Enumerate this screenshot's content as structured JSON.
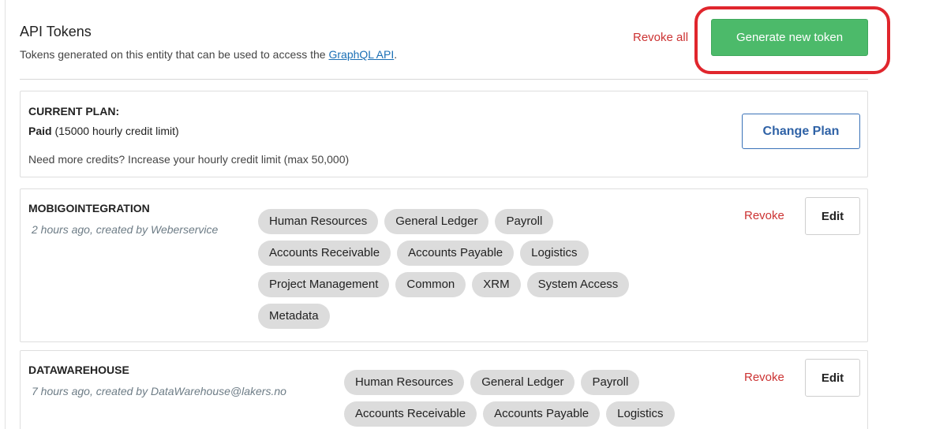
{
  "header": {
    "title": "API Tokens",
    "description_prefix": "Tokens generated on this entity that can be used to access the ",
    "description_link": "GraphQL API",
    "description_suffix": ".",
    "revoke_all_label": "Revoke all",
    "generate_label": "Generate new token"
  },
  "plan": {
    "label": "CURRENT PLAN:",
    "tier": "Paid",
    "limit": "(15000 hourly credit limit)",
    "upsell": "Need more credits? Increase your hourly credit limit (max 50,000)",
    "change_label": "Change Plan"
  },
  "tokens": [
    {
      "name": "MOBIGOINTEGRATION",
      "meta": "2 hours ago, created by Weberservice",
      "scopes": [
        "Human Resources",
        "General Ledger",
        "Payroll",
        "Accounts Receivable",
        "Accounts Payable",
        "Logistics",
        "Project Management",
        "Common",
        "XRM",
        "System Access",
        "Metadata"
      ],
      "revoke_label": "Revoke",
      "edit_label": "Edit"
    },
    {
      "name": "DATAWAREHOUSE",
      "meta": "7 hours ago, created by DataWarehouse@lakers.no",
      "scopes": [
        "Human Resources",
        "General Ledger",
        "Payroll",
        "Accounts Receivable",
        "Accounts Payable",
        "Logistics"
      ],
      "revoke_label": "Revoke",
      "edit_label": "Edit"
    }
  ],
  "colors": {
    "primary_green": "#4cba6a",
    "danger_red": "#cc3333",
    "link_blue": "#1a6fb5",
    "annotation_red": "#e0262d"
  }
}
